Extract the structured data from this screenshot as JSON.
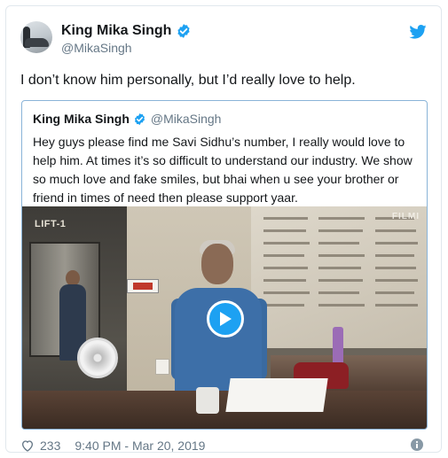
{
  "author": {
    "name": "King Mika Singh",
    "handle": "@MikaSingh"
  },
  "tweet": {
    "text": "I don’t know him personally, but I’d really love to help."
  },
  "quoted": {
    "name": "King Mika Singh",
    "handle": "@MikaSingh",
    "text": "Hey guys please find me Savi Sidhu’s number, I really would love to help him. At times it’s so difficult to understand our industry. We show so much love and fake smiles, but bhai when u see your brother or friend in times of need then please support yaar.",
    "media_lift_label": "LIFT-1",
    "media_watermark": "FILMI"
  },
  "footer": {
    "likes": "233",
    "timestamp": "9:40 PM - Mar 20, 2019"
  },
  "colors": {
    "twitter_blue": "#1da1f2",
    "secondary_text": "#657786",
    "quote_border": "#8ab4d8"
  },
  "icons": [
    "verified-icon",
    "twitter-bird-icon",
    "play-icon",
    "heart-icon",
    "info-icon"
  ]
}
